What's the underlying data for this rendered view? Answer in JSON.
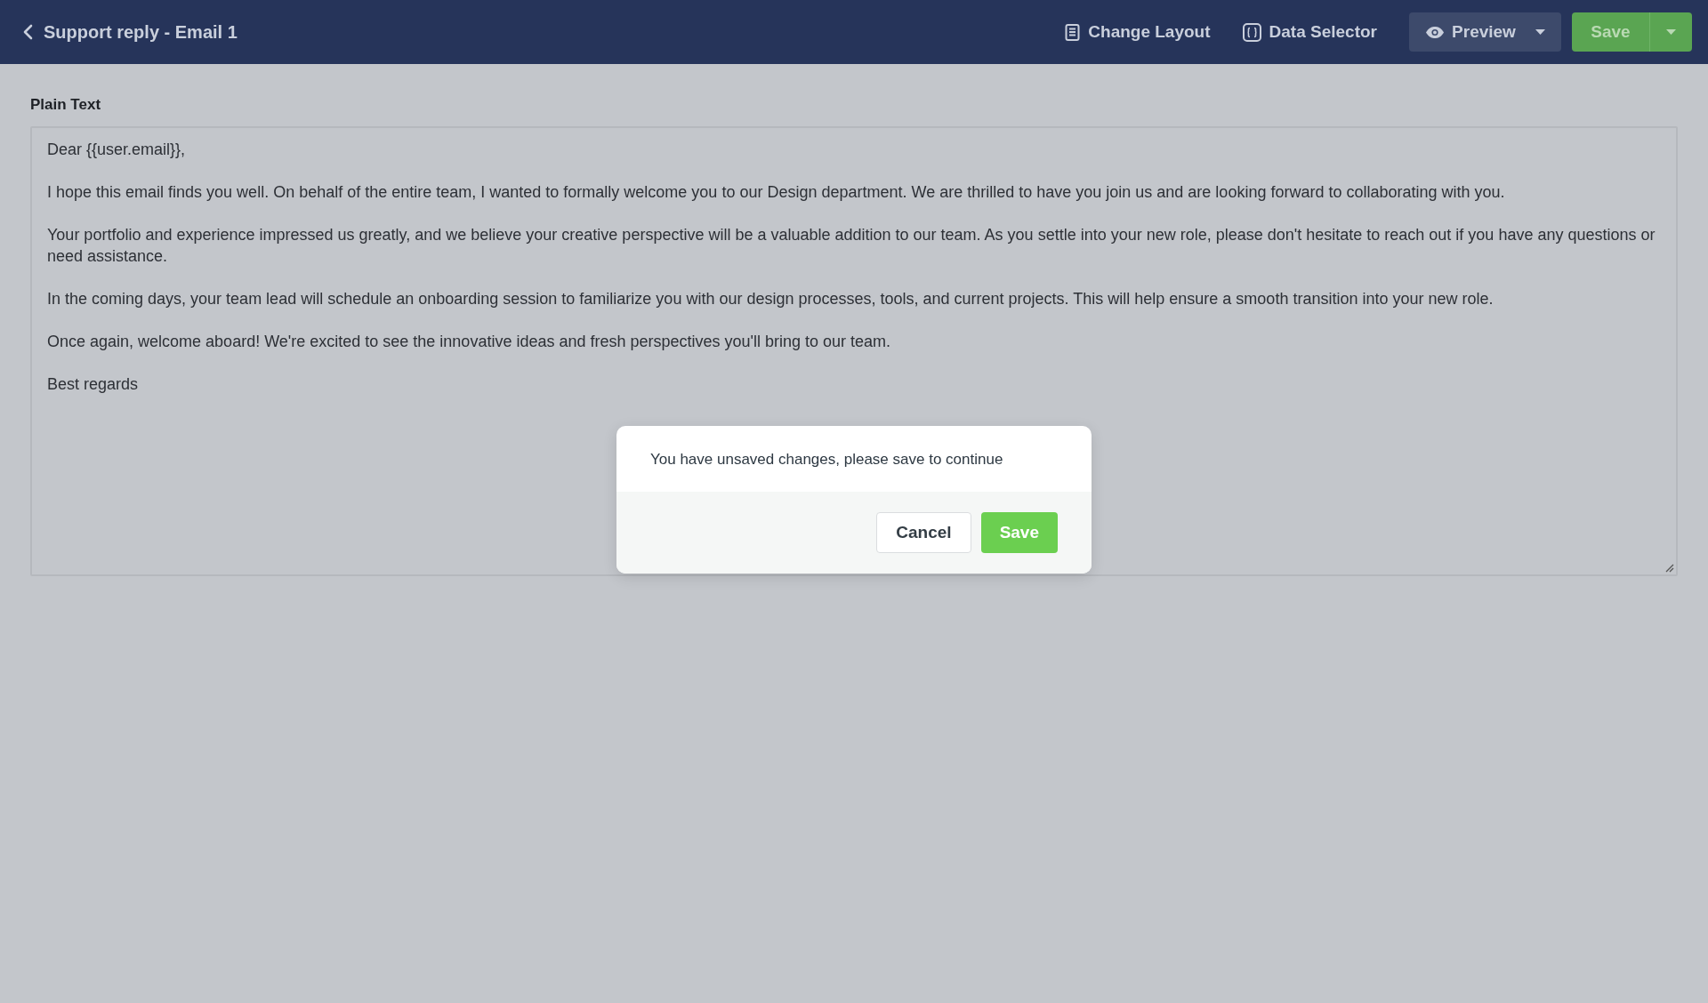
{
  "header": {
    "title": "Support reply - Email 1",
    "actions": [
      {
        "kind": "layout",
        "label": "Change Layout"
      },
      {
        "kind": "data",
        "label": "Data Selector"
      }
    ],
    "preview": {
      "label": "Preview"
    },
    "save": {
      "label": "Save"
    }
  },
  "editor": {
    "label": "Plain Text",
    "paragraphs": [
      "Dear {{user.email}},",
      "I hope this email finds you well. On behalf of the entire team, I wanted to formally welcome you to our Design department. We are thrilled to have you join us and are looking forward to collaborating with you.",
      "Your portfolio and experience impressed us greatly, and we believe your creative perspective will be a valuable addition to our team. As you settle into your new role, please don't hesitate to reach out if you have any questions or need assistance.",
      "In the coming days, your team lead will schedule an onboarding session to familiarize you with our design processes, tools, and current projects. This will help ensure a smooth transition into your new role.",
      "Once again, welcome aboard! We're excited to see the innovative ideas and fresh perspectives you'll bring to our team.",
      "Best regards"
    ]
  },
  "dialog": {
    "message": "You have unsaved changes, please save to continue",
    "buttons": [
      {
        "kind": "secondary",
        "label": "Cancel"
      },
      {
        "kind": "primary",
        "label": "Save"
      }
    ]
  }
}
